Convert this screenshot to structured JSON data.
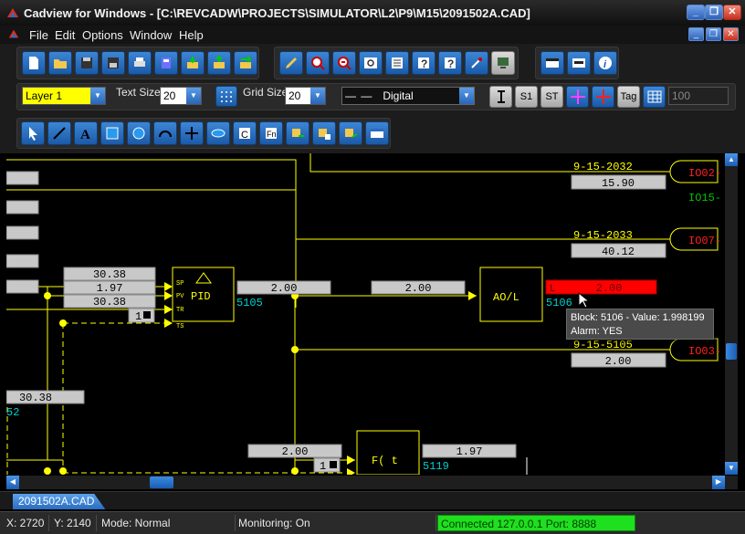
{
  "window": {
    "title": "Cadview for Windows - [C:\\REVCADW\\PROJECTS\\SIMULATOR\\L2\\P9\\M15\\2091502A.CAD]",
    "controls": [
      "_",
      "❐",
      "✕"
    ]
  },
  "menu": {
    "items": [
      "File",
      "Edit",
      "Options",
      "Window",
      "Help"
    ]
  },
  "toolbar": {
    "layer": "Layer 1",
    "text_size_label": "Text Size",
    "text_size": "20",
    "grid_size_label": "Grid Size",
    "grid_size": "20",
    "line_style": "Digital",
    "tag_label": "Tag",
    "value_field": "100",
    "s1_label": "S1",
    "st_label": "ST"
  },
  "diagram": {
    "tags": {
      "t2032": "9-15-2032",
      "t2033": "9-15-2033",
      "t5105": "9-15-5105"
    },
    "values": {
      "v2032": "15.90",
      "v2033": "40.12",
      "v5105": "2.00",
      "pid_sp": "30.38",
      "pid_pv": "1.97",
      "pid_tr": "30.38",
      "pid_out": "2.00",
      "ao_in": "2.00",
      "ao_out": "2.00",
      "ao_flag": "L",
      "left_val": "30.38",
      "f_in": "2.00",
      "f_out": "1.97",
      "one_a": "1",
      "one_b": "1"
    },
    "blocks": {
      "pid_label": "PID",
      "pid_sp": "SP",
      "pid_pv": "PV",
      "pid_tr": "TR",
      "pid_ts": "TS",
      "pid_num": "5105",
      "ao_label": "AO/L",
      "ao_num": "5106",
      "f_label": "F( t",
      "f_num": "5119",
      "left_num": "52"
    },
    "io": {
      "io002": "IO02-",
      "io015": "IO15-",
      "io007": "IO07-",
      "io003": "IO03-"
    }
  },
  "tooltip": {
    "line1": "Block: 5106 - Value: 1.998199",
    "line2": "Alarm: YES"
  },
  "tab": {
    "label": "2091502A.CAD"
  },
  "status": {
    "x": "X: 2720",
    "y": "Y: 2140",
    "mode": "Mode: Normal",
    "monitoring": "Monitoring: On",
    "connection": "Connected 127.0.0.1   Port: 8888"
  },
  "colors": {
    "wire": "#ffff00",
    "value_box": "#c8c8c8",
    "alarm": "#ff0000",
    "tag_text": "#ffff00",
    "io_text": "#ff2020",
    "io_green": "#00c000",
    "block_number": "#00d0d0",
    "connected": "#1ee01e"
  }
}
